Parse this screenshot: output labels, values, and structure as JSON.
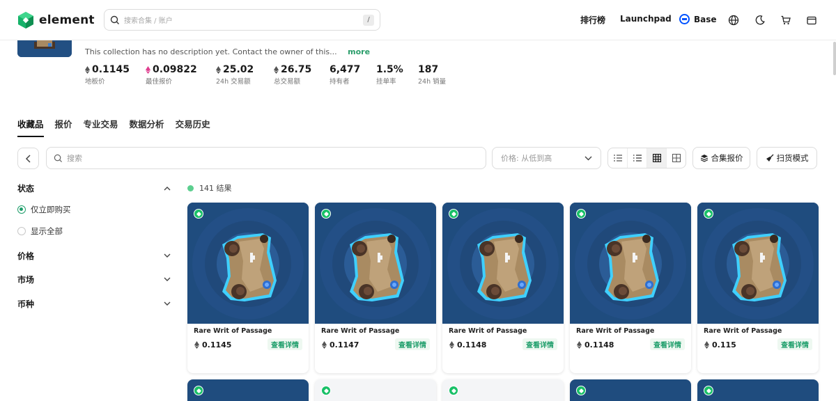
{
  "header": {
    "logo_text": "element",
    "search_placeholder": "搜索合集 / 账户",
    "search_shortcut": "/",
    "nav": {
      "ranking": "排行榜",
      "launchpad": "Launchpad"
    },
    "chain": "Base",
    "icons": [
      "globe-icon",
      "moon-icon",
      "cart-icon",
      "wallet-icon"
    ]
  },
  "collection": {
    "description": "This collection has no description yet. Contact the owner of this...",
    "more": "more",
    "stats": [
      {
        "value": "0.1145",
        "label": "地板价",
        "eth": true,
        "pink": false
      },
      {
        "value": "0.09822",
        "label": "最佳报价",
        "eth": true,
        "pink": true
      },
      {
        "value": "25.02",
        "label": "24h 交易额",
        "eth": true,
        "pink": false
      },
      {
        "value": "26.75",
        "label": "总交易额",
        "eth": true,
        "pink": false
      },
      {
        "value": "6,477",
        "label": "持有者",
        "eth": false,
        "pink": false
      },
      {
        "value": "1.5%",
        "label": "挂单率",
        "eth": false,
        "pink": false
      },
      {
        "value": "187",
        "label": "24h 销量",
        "eth": false,
        "pink": false
      }
    ]
  },
  "tabs": [
    "收藏品",
    "报价",
    "专业交易",
    "数据分析",
    "交易历史"
  ],
  "toolbar": {
    "search_placeholder": "搜索",
    "sort_label": "价格: 从低到高",
    "collection_offer": "合集报价",
    "sweep_mode": "扫货模式"
  },
  "filters": {
    "status_title": "状态",
    "buy_now": "仅立即购买",
    "show_all": "显示全部",
    "price": "价格",
    "market": "市场",
    "currency": "币种"
  },
  "results": {
    "count_label": "141 结果"
  },
  "items": [
    {
      "name": "Rare Writ of Passage",
      "price": "0.1145",
      "button": "查看详情"
    },
    {
      "name": "Rare Writ of Passage",
      "price": "0.1147",
      "button": "查看详情"
    },
    {
      "name": "Rare Writ of Passage",
      "price": "0.1148",
      "button": "查看详情"
    },
    {
      "name": "Rare Writ of Passage",
      "price": "0.1148",
      "button": "查看详情"
    },
    {
      "name": "Rare Writ of Passage",
      "price": "0.115",
      "button": "查看详情"
    }
  ],
  "colors": {
    "accent": "#1f9e6b",
    "card_bg": "#1f4c7e",
    "base_blue": "#0052ff"
  }
}
